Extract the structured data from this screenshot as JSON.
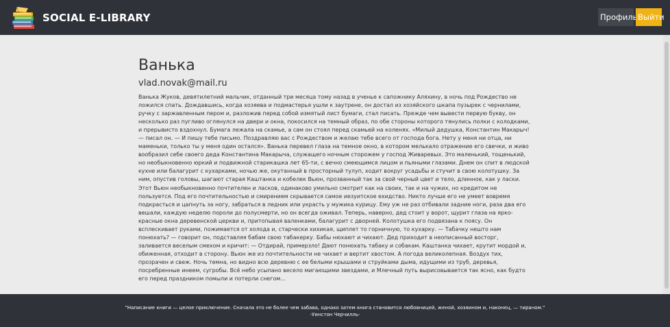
{
  "navbar": {
    "brand": "SOCIAL E-LIBRARY",
    "logo_icon": "books-icon",
    "profile_label": "Профиль",
    "logout_label": "Выйти",
    "colors": {
      "background": "#2f3238",
      "accent": "#f0b315"
    }
  },
  "book": {
    "title": "Ванька",
    "author": "vlad.novak@mail.ru",
    "text": "Ванька Жуков, девятилетний мальчик, отданный три месяца тому назад в ученье к сапожнику Аляхину, в ночь под Рождество не ложился спать. Дождавшись, когда хозяева и подмастерья ушли к заутрене, он достал из хозяйского шкапа пузырек с чернилами, ручку с заржавленным пером и, разложив перед собой измятый лист бумаги, стал писать. Прежде чем вывести первую букву, он несколько раз пугливо оглянулся на двери и окна, покосился на темный образ, по обе стороны которого тянулись полки с колодками, и прерывисто вздохнул. Бумага лежала на скамье, а сам он стоял перед скамьей на коленях. «Милый дедушка, Константин Макарыч! — писал он. — И пишу тебе письмо. Поздравляю вас с Рождеством и желаю тебе всего от господа бога. Нету у меня ни отца, ни маменьки, только ты у меня один остался». Ванька перевел глаза на темное окно, в котором мелькало отражение его свечки, и живо вообразил себе своего деда Константина Макарыча, служащего ночным сторожем у господ Живаревых. Это маленький, тощенький, но необыкновенно юркий и подвижной старикашка лет 65-ти, с вечно смеющимся лицом и пьяными глазами. Днем он спит в людской кухне или балагурит с кухарками, ночью же, окутанный в просторный тулуп, ходит вокруг усадьбы и стучит в свою колотушку. За ним, опустив головы, шагают старая Каштанка и кобелек Вьюн, прозванный так за свой черный цвет и тело, длинное, как у ласки. Этот Вьюн необыкновенно почтителен и ласков, одинаково умильно смотрит как на своих, так и на чужих, но кредитом не пользуется. Под его почтительностью и смирением скрывается самое иезуитское ехидство. Никто лучше его не умеет вовремя подкрасться и цапнуть за ногу, забраться в ледник или украсть у мужика курицу. Ему уж не раз отбивали задние ноги, раза два его вешали, каждую неделю пороли до полусмерти, но он всегда оживал. Теперь, наверно, дед стоит у ворот, щурит глаза на ярко-красные окна деревенской церкви и, притопывая валенками, балагурит с дворней. Колотушка его подвязана к поясу. Он всплескивает руками, пожимается от холода и, старчески хихикая, щиплет то горничную, то кухарку. — Табачку нешто нам понюхать? — говорит он, подставляя бабам свою табакерку. Бабы нюхают и чихают. Дед приходит в неописанный восторг, заливается веселым смехом и кричит: — Отдирай, примерзло! Дают понюхать табаку и собакам. Каштанка чихает, крутит мордой и, обиженная, отходит в сторону. Вьюн же из почтительности не чихает и вертит хвостом. А погода великолепная. Воздух тих, прозрачен и свеж. Ночь темна, но видно всю деревню с ее белыми крышами и струйками дыма, идущими из труб, деревья, посребренные инеем, сугробы. Всё небо усыпано весело мигающими звездами, и Млечный путь вырисовывается так ясно, как будто его перед праздником помыли и потерли снегом..."
  },
  "footer": {
    "quote": "\"Написание книги — целое приключение. Сначала это не более чем забава, однако затем книга становится любовницей, женой, хозяином и, наконец, — тираном.\"",
    "quote_author": "-Уинстон Черчилль-"
  }
}
